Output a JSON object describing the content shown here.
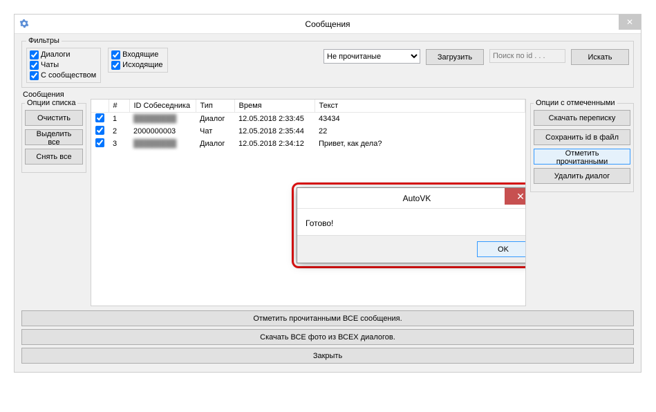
{
  "window": {
    "title": "Сообщения"
  },
  "filters": {
    "legend": "Фильтры",
    "group1": [
      {
        "label": "Диалоги",
        "checked": true
      },
      {
        "label": "Чаты",
        "checked": true
      },
      {
        "label": "С сообществом",
        "checked": true
      }
    ],
    "group2": [
      {
        "label": "Входящие",
        "checked": true
      },
      {
        "label": "Исходящие",
        "checked": true
      }
    ],
    "combo_value": "Не прочитаные",
    "load_btn": "Загрузить",
    "search_placeholder": "Поиск по id . . .",
    "search_btn": "Искать"
  },
  "messages": {
    "legend": "Сообщения",
    "list_options": {
      "legend": "Опции списка",
      "clear": "Очистить",
      "select_all": "Выделить все",
      "deselect_all": "Снять все"
    },
    "marked_options": {
      "legend": "Опции с отмеченными",
      "download_chat": "Скачать переписку",
      "save_id": "Сохранить id в файл",
      "mark_read": "Отметить прочитанными",
      "delete_dlg": "Удалить диалог"
    },
    "columns": {
      "num": "#",
      "id": "ID Собеседника",
      "type": "Тип",
      "time": "Время",
      "text": "Текст"
    },
    "rows": [
      {
        "checked": true,
        "num": "1",
        "id": "████████",
        "id_blur": true,
        "type": "Диалог",
        "time": "12.05.2018 2:33:45",
        "text": "43434"
      },
      {
        "checked": true,
        "num": "2",
        "id": "2000000003",
        "id_blur": false,
        "type": "Чат",
        "time": "12.05.2018 2:35:44",
        "text": "22"
      },
      {
        "checked": true,
        "num": "3",
        "id": "████████",
        "id_blur": true,
        "type": "Диалог",
        "time": "12.05.2018 2:34:12",
        "text": "Привет, как дела?"
      }
    ]
  },
  "bottom": {
    "mark_all": "Отметить прочитанными ВСЕ сообщения.",
    "download_all": "Скачать ВСЕ фото из ВСЕХ диалогов.",
    "close": "Закрыть"
  },
  "dialog": {
    "title": "AutoVK",
    "message": "Готово!",
    "ok": "OK"
  }
}
